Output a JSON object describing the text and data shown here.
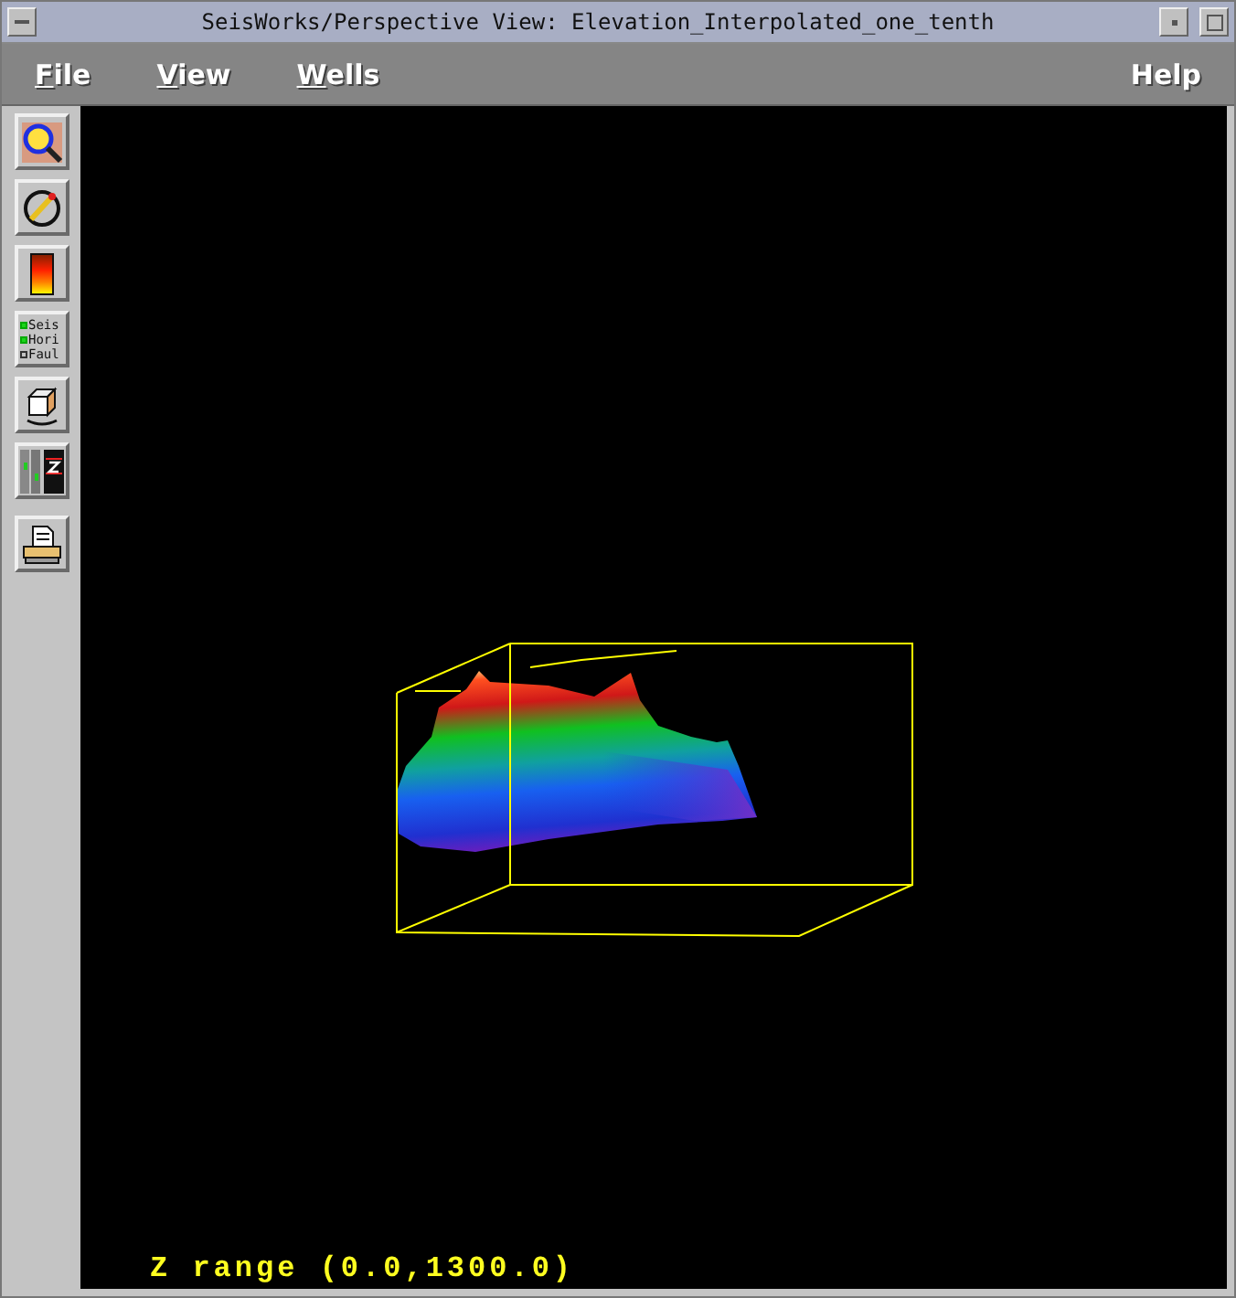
{
  "window": {
    "title": "SeisWorks/Perspective View: Elevation_Interpolated_one_tenth"
  },
  "menu_bar": [
    {
      "label": "File",
      "mnemonic": true
    },
    {
      "label": "View",
      "mnemonic": true
    },
    {
      "label": "Wells",
      "mnemonic": true
    },
    {
      "label": "Help",
      "mnemonic": false
    }
  ],
  "toolbar": [
    {
      "kind": "zoom"
    },
    {
      "kind": "rotate"
    },
    {
      "kind": "colorbar"
    },
    {
      "kind": "layers",
      "layers": [
        {
          "label": "Seis",
          "checked": true
        },
        {
          "label": "Hori",
          "checked": true
        },
        {
          "label": "Faul",
          "checked": false
        }
      ]
    },
    {
      "kind": "cube"
    },
    {
      "kind": "zscale"
    },
    {
      "kind": "print"
    }
  ],
  "view": {
    "z_range": "Z range (0.0,1300.0)"
  }
}
